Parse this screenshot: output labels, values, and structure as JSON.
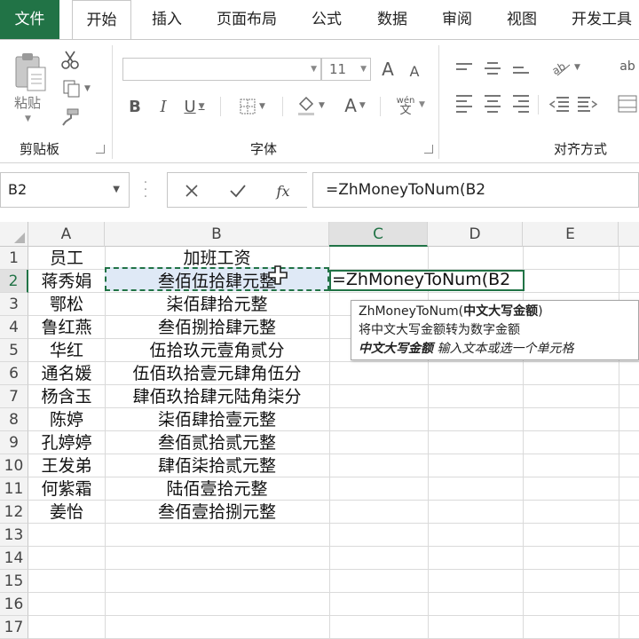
{
  "ribbon": {
    "tabs": [
      "文件",
      "开始",
      "插入",
      "页面布局",
      "公式",
      "数据",
      "审阅",
      "视图",
      "开发工具"
    ],
    "paste_label": "粘贴",
    "font_size": "11",
    "groups": {
      "clipboard": "剪贴板",
      "font": "字体",
      "alignment": "对齐方式"
    },
    "font_buttons": {
      "bold": "B",
      "italic": "I",
      "underline": "U",
      "bigger": "A",
      "smaller": "A",
      "color": "A",
      "wen": "wén",
      "wen_sub": "文"
    }
  },
  "formula_bar": {
    "name_box": "B2",
    "fx": "fx",
    "formula": "=ZhMoneyToNum(B2"
  },
  "grid": {
    "columns": [
      "A",
      "B",
      "C",
      "D",
      "E"
    ],
    "rows": [
      "1",
      "2",
      "3",
      "4",
      "5",
      "6",
      "7",
      "8",
      "9",
      "10",
      "11",
      "12",
      "13",
      "14",
      "15",
      "16",
      "17"
    ],
    "header": {
      "name": "员工",
      "pay": "加班工资"
    },
    "data": [
      {
        "name": "蒋秀娟",
        "pay": "叁佰伍拾肆元整"
      },
      {
        "name": "鄂松",
        "pay": "柒佰肆拾元整"
      },
      {
        "name": "鲁红燕",
        "pay": "叁佰捌拾肆元整"
      },
      {
        "name": "华红",
        "pay": "伍拾玖元壹角贰分"
      },
      {
        "name": "通名媛",
        "pay": "伍佰玖拾壹元肆角伍分"
      },
      {
        "name": "杨含玉",
        "pay": "肆佰玖拾肆元陆角柒分"
      },
      {
        "name": "陈婷",
        "pay": "柒佰肆拾壹元整"
      },
      {
        "name": "孔婷婷",
        "pay": "叁佰贰拾贰元整"
      },
      {
        "name": "王发弟",
        "pay": "肆佰柒拾贰元整"
      },
      {
        "name": "何紫霜",
        "pay": "陆佰壹拾元整"
      },
      {
        "name": "姜怡",
        "pay": "叁佰壹拾捌元整"
      }
    ],
    "c2_text": "=ZhMoneyToNum(B2"
  },
  "tooltip": {
    "func": "ZhMoneyToNum(",
    "arg": "中文大写金额",
    "close": ")",
    "desc": "将中文大写金额转为数字金额",
    "arg_name": "中文大写金额",
    "arg_desc": "输入文本或选一个单元格"
  },
  "colors": {
    "accent": "#217346",
    "selection": "#dfe9f6"
  }
}
